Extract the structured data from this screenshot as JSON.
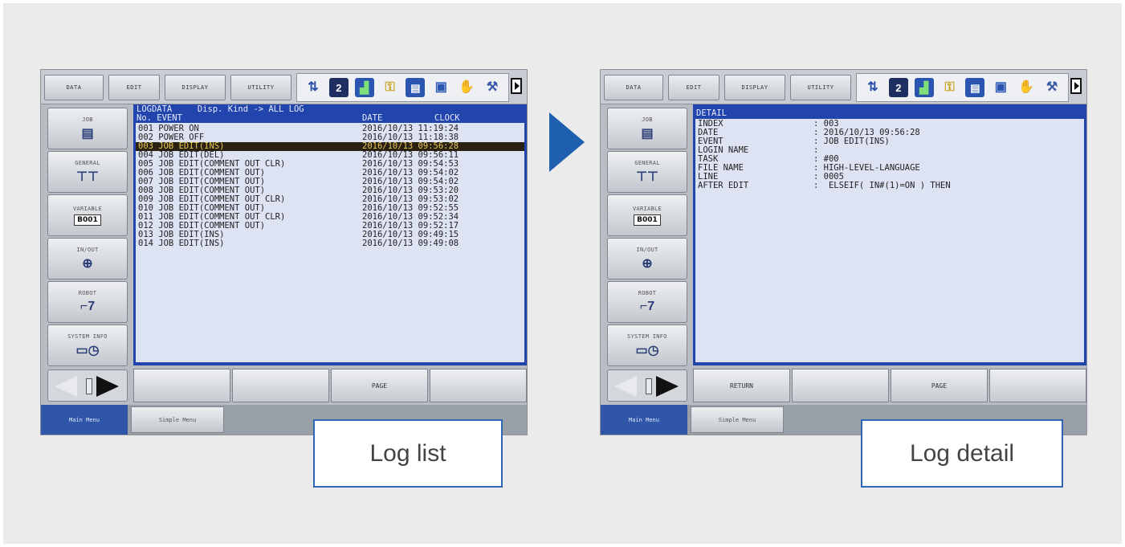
{
  "pendant_common": {
    "menus": [
      "DATA",
      "EDIT",
      "DISPLAY",
      "UTILITY"
    ],
    "side_buttons": {
      "job": "JOB",
      "general": "GENERAL",
      "variable": "VARIABLE",
      "variable_box": "B001",
      "in_out": "IN/OUT",
      "robot": "ROBOT",
      "system_info": "SYSTEM INFO"
    },
    "tabs": {
      "main": "Main Menu",
      "simple": "Simple Menu"
    },
    "status_icons": [
      "inch-mode-icon",
      "cycle-icon",
      "signal-level-icon",
      "security-icon",
      "job-list-icon",
      "teach-icon",
      "hand-icon",
      "tool-icon"
    ]
  },
  "log_list": {
    "caption": "Log list",
    "header_line1": "LOGDATA     Disp. Kind -> ALL LOG",
    "header_col_event": "No. EVENT",
    "header_col_date": "DATE",
    "header_col_clock": "CLOCK",
    "rows": [
      {
        "event": "001 POWER ON",
        "datetime": "2016/10/13 11:19:24"
      },
      {
        "event": "002 POWER OFF",
        "datetime": "2016/10/13 11:18:38"
      },
      {
        "event": "003 JOB EDIT(INS)",
        "datetime": "2016/10/13 09:56:28"
      },
      {
        "event": "004 JOB EDIT(DEL)",
        "datetime": "2016/10/13 09:56:11"
      },
      {
        "event": "005 JOB EDIT(COMMENT OUT CLR)",
        "datetime": "2016/10/13 09:54:53"
      },
      {
        "event": "006 JOB EDIT(COMMENT OUT)",
        "datetime": "2016/10/13 09:54:02"
      },
      {
        "event": "007 JOB EDIT(COMMENT OUT)",
        "datetime": "2016/10/13 09:54:02"
      },
      {
        "event": "008 JOB EDIT(COMMENT OUT)",
        "datetime": "2016/10/13 09:53:20"
      },
      {
        "event": "009 JOB EDIT(COMMENT OUT CLR)",
        "datetime": "2016/10/13 09:53:02"
      },
      {
        "event": "010 JOB EDIT(COMMENT OUT)",
        "datetime": "2016/10/13 09:52:55"
      },
      {
        "event": "011 JOB EDIT(COMMENT OUT CLR)",
        "datetime": "2016/10/13 09:52:34"
      },
      {
        "event": "012 JOB EDIT(COMMENT OUT)",
        "datetime": "2016/10/13 09:52:17"
      },
      {
        "event": "013 JOB EDIT(INS)",
        "datetime": "2016/10/13 09:49:15"
      },
      {
        "event": "014 JOB EDIT(INS)",
        "datetime": "2016/10/13 09:49:08"
      }
    ],
    "selected_index": 2,
    "fkeys": [
      "",
      "",
      "PAGE",
      ""
    ]
  },
  "log_detail": {
    "caption": "Log detail",
    "header": "DETAIL",
    "fields": [
      {
        "label": "INDEX",
        "value": ": 003"
      },
      {
        "label": "DATE",
        "value": ": 2016/10/13 09:56:28"
      },
      {
        "label": "EVENT",
        "value": ": JOB EDIT(INS)"
      },
      {
        "label": "LOGIN NAME",
        "value": ":"
      },
      {
        "label": "TASK",
        "value": ": #00"
      },
      {
        "label": "FILE NAME",
        "value": ": HIGH-LEVEL-LANGUAGE"
      },
      {
        "label": "LINE",
        "value": ": 0005"
      },
      {
        "label": "AFTER EDIT",
        "value": ":  ELSEIF( IN#(1)=ON ) THEN"
      }
    ],
    "fkeys": [
      "RETURN",
      "",
      "PAGE",
      ""
    ]
  },
  "colors": {
    "screen_header": "#2144ad",
    "screen_body": "#dde3f3",
    "selected_row_bg": "#2a2110",
    "selected_row_text": "#e8c85a",
    "arrow": "#1f5fb0",
    "caption_border": "#2f67b6"
  }
}
